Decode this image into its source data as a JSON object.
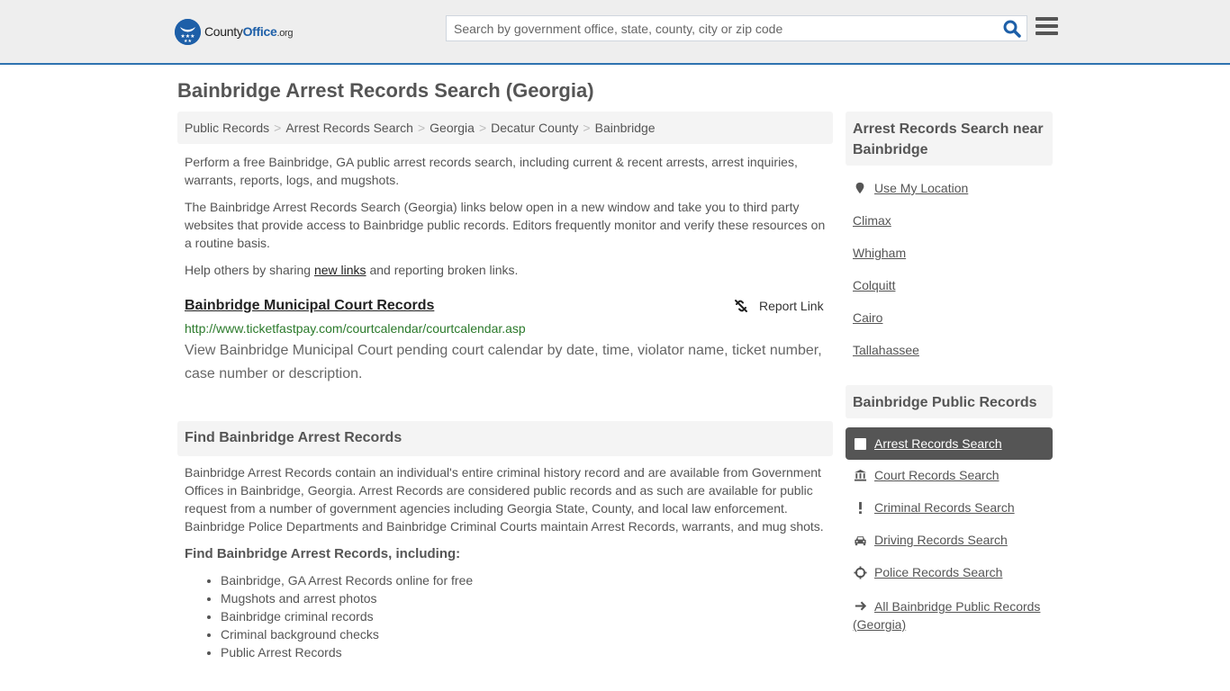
{
  "header": {
    "logo": {
      "county": "County",
      "office": "Office",
      "tld": ".org"
    },
    "search_placeholder": "Search by government office, state, county, city or zip code",
    "accent_color": "#2f73b0"
  },
  "page_title": "Bainbridge Arrest Records Search (Georgia)",
  "breadcrumb": [
    "Public Records",
    "Arrest Records Search",
    "Georgia",
    "Decatur County",
    "Bainbridge"
  ],
  "intro": {
    "p1": "Perform a free Bainbridge, GA public arrest records search, including current & recent arrests, arrest inquiries, warrants, reports, logs, and mugshots.",
    "p2": "The Bainbridge Arrest Records Search (Georgia) links below open in a new window and take you to third party websites that provide access to Bainbridge public records. Editors frequently monitor and verify these resources on a routine basis.",
    "p3_before": "Help others by sharing ",
    "p3_link": "new links",
    "p3_after": " and reporting broken links."
  },
  "resource": {
    "title": "Bainbridge Municipal Court Records",
    "report_label": "Report Link",
    "url": "http://www.ticketfastpay.com/courtcalendar/courtcalendar.asp",
    "description": "View Bainbridge Municipal Court pending court calendar by date, time, violator name, ticket number, case number or description."
  },
  "find_section": {
    "heading": "Find Bainbridge Arrest Records",
    "body": "Bainbridge Arrest Records contain an individual's entire criminal history record and are available from Government Offices in Bainbridge, Georgia. Arrest Records are considered public records and as such are available for public request from a number of government agencies including Georgia State, County, and local law enforcement. Bainbridge Police Departments and Bainbridge Criminal Courts maintain Arrest Records, warrants, and mug shots.",
    "subheading": "Find Bainbridge Arrest Records, including:",
    "items": [
      "Bainbridge, GA Arrest Records online for free",
      "Mugshots and arrest photos",
      "Bainbridge criminal records",
      "Criminal background checks",
      "Public Arrest Records"
    ]
  },
  "sidebar": {
    "nearby_heading": "Arrest Records Search near Bainbridge",
    "use_location": "Use My Location",
    "nearby": [
      "Climax",
      "Whigham",
      "Colquitt",
      "Cairo",
      "Tallahassee"
    ],
    "public_heading": "Bainbridge Public Records",
    "records": [
      {
        "label": "Arrest Records Search",
        "icon": "square-icon",
        "active": true
      },
      {
        "label": "Court Records Search",
        "icon": "bank-icon",
        "active": false
      },
      {
        "label": "Criminal Records Search",
        "icon": "exclamation-icon",
        "active": false
      },
      {
        "label": "Driving Records Search",
        "icon": "car-icon",
        "active": false
      },
      {
        "label": "Police Records Search",
        "icon": "crosshair-icon",
        "active": false
      }
    ],
    "all_records": "All Bainbridge Public Records (Georgia)"
  }
}
